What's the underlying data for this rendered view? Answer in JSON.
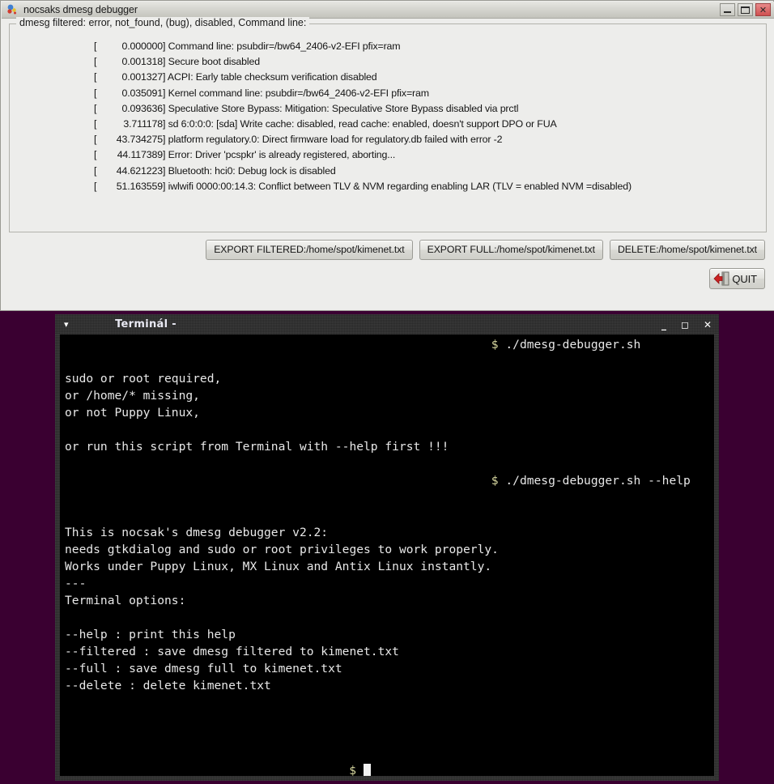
{
  "desktop": {
    "background_color": "#3a0031"
  },
  "gtk_window": {
    "title": "nocsaks dmesg debugger",
    "icon": "app-icon",
    "window_buttons": [
      {
        "name": "minimize",
        "glyph": "–"
      },
      {
        "name": "maximize",
        "glyph": "□"
      },
      {
        "name": "close",
        "glyph": "✕"
      }
    ],
    "frame_legend": "dmesg filtered: error, not_found, (bug), disabled, Command line:",
    "dmesg_lines": [
      {
        "stamp": "0.000000",
        "text": "Command line: psubdir=/bw64_2406-v2-EFI pfix=ram"
      },
      {
        "stamp": "0.001318",
        "text": "Secure boot disabled"
      },
      {
        "stamp": "0.001327",
        "text": "ACPI: Early table checksum verification disabled"
      },
      {
        "stamp": "0.035091",
        "text": "Kernel command line: psubdir=/bw64_2406-v2-EFI pfix=ram"
      },
      {
        "stamp": "0.093636",
        "text": "Speculative Store Bypass: Mitigation: Speculative Store Bypass disabled via prctl"
      },
      {
        "stamp": "3.711178",
        "text": "sd 6:0:0:0: [sda] Write cache: disabled, read cache: enabled, doesn't support DPO or FUA"
      },
      {
        "stamp": "43.734275",
        "text": "platform regulatory.0: Direct firmware load for regulatory.db failed with error -2"
      },
      {
        "stamp": "44.117389",
        "text": "Error: Driver 'pcspkr' is already registered, aborting..."
      },
      {
        "stamp": "44.621223",
        "text": "Bluetooth: hci0: Debug lock is disabled"
      },
      {
        "stamp": "51.163559",
        "text": "iwlwifi 0000:00:14.3: Conflict between TLV & NVM regarding enabling LAR (TLV = enabled NVM =disabled)"
      }
    ],
    "buttons": [
      {
        "name": "export-filtered",
        "label": "EXPORT FILTERED:/home/spot/kimenet.txt"
      },
      {
        "name": "export-full",
        "label": "EXPORT FULL:/home/spot/kimenet.txt"
      },
      {
        "name": "delete",
        "label": "DELETE:/home/spot/kimenet.txt"
      }
    ],
    "quit_button": {
      "label": "QUIT",
      "icon": "exit-door-icon"
    }
  },
  "terminal_window": {
    "title": "Terminál -",
    "menu_icon": "chevron-down-icon",
    "window_buttons": [
      {
        "name": "minimize",
        "glyph": "_"
      },
      {
        "name": "maximize",
        "glyph": "□"
      },
      {
        "name": "close",
        "glyph": "✕"
      }
    ],
    "lines": [
      {
        "indent": 60,
        "prompt": "$",
        "text": " ./dmesg-debugger.sh"
      },
      {
        "indent": 0,
        "prompt": "",
        "text": ""
      },
      {
        "indent": 0,
        "prompt": "",
        "text": "sudo or root required,"
      },
      {
        "indent": 0,
        "prompt": "",
        "text": "or /home/* missing,"
      },
      {
        "indent": 0,
        "prompt": "",
        "text": "or not Puppy Linux,"
      },
      {
        "indent": 0,
        "prompt": "",
        "text": ""
      },
      {
        "indent": 0,
        "prompt": "",
        "text": "or run this script from Terminal with --help first !!!"
      },
      {
        "indent": 0,
        "prompt": "",
        "text": ""
      },
      {
        "indent": 60,
        "prompt": "$",
        "text": " ./dmesg-debugger.sh --help"
      },
      {
        "indent": 0,
        "prompt": "",
        "text": ""
      },
      {
        "indent": 0,
        "prompt": "",
        "text": ""
      },
      {
        "indent": 0,
        "prompt": "",
        "text": "This is nocsak's dmesg debugger v2.2:"
      },
      {
        "indent": 0,
        "prompt": "",
        "text": "needs gtkdialog and sudo or root privileges to work properly."
      },
      {
        "indent": 0,
        "prompt": "",
        "text": "Works under Puppy Linux, MX Linux and Antix Linux instantly."
      },
      {
        "indent": 0,
        "prompt": "",
        "text": "---"
      },
      {
        "indent": 0,
        "prompt": "",
        "text": "Terminal options:"
      },
      {
        "indent": 0,
        "prompt": "",
        "text": ""
      },
      {
        "indent": 0,
        "prompt": "",
        "text": "--help : print this help"
      },
      {
        "indent": 0,
        "prompt": "",
        "text": "--filtered : save dmesg filtered to kimenet.txt"
      },
      {
        "indent": 0,
        "prompt": "",
        "text": "--full : save dmesg full to kimenet.txt"
      },
      {
        "indent": 0,
        "prompt": "",
        "text": "--delete : delete kimenet.txt"
      },
      {
        "indent": 0,
        "prompt": "",
        "text": ""
      },
      {
        "indent": 0,
        "prompt": "",
        "text": ""
      },
      {
        "indent": 0,
        "prompt": "",
        "text": ""
      },
      {
        "indent": 0,
        "prompt": "",
        "text": ""
      }
    ],
    "final_prompt": {
      "indent": 40,
      "prompt": "$",
      "cursor": true
    }
  }
}
